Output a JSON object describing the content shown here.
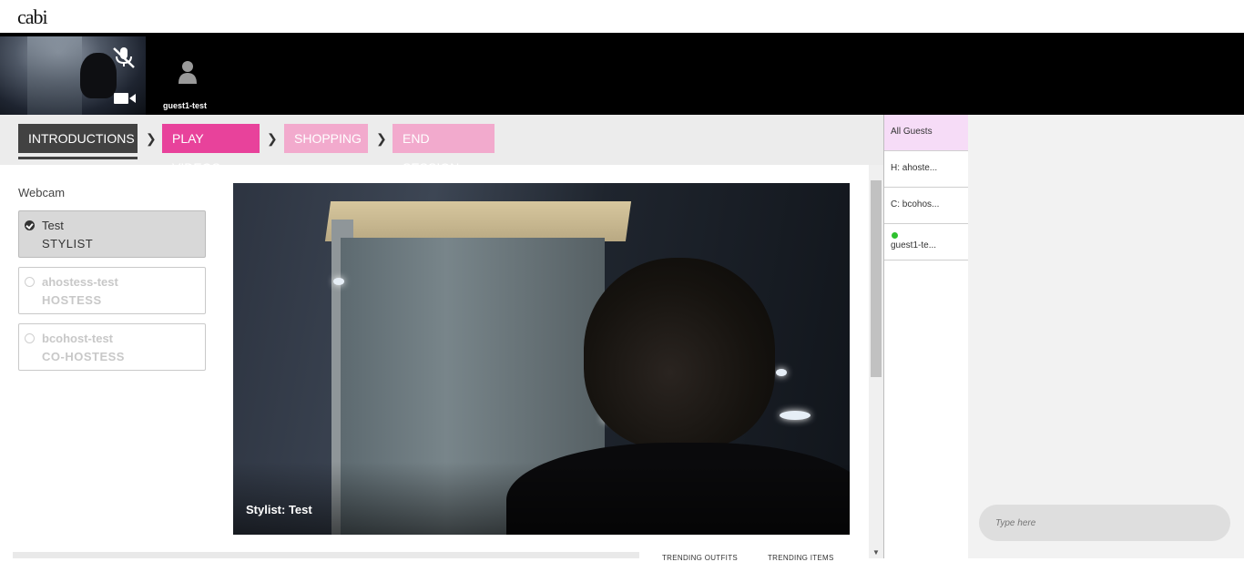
{
  "app": {
    "logo": "cabi"
  },
  "video_strip": {
    "guest_name": "guest1-test"
  },
  "steps": {
    "items": [
      {
        "label": "INTRODUCTIONS",
        "state": "active"
      },
      {
        "label": "PLAY VIDEOS",
        "state": "current"
      },
      {
        "label": "SHOPPING",
        "state": "upcoming"
      },
      {
        "label": "END SESSION",
        "state": "upcoming"
      }
    ]
  },
  "webcam": {
    "label": "Webcam",
    "participants": [
      {
        "name": "Test",
        "role": "STYLIST",
        "selected": true
      },
      {
        "name": "ahostess-test",
        "role": "HOSTESS",
        "selected": false
      },
      {
        "name": "bcohost-test",
        "role": "CO-HOSTESS",
        "selected": false
      }
    ]
  },
  "stage": {
    "caption": "Stylist: Test"
  },
  "bottom_tabs": [
    "TRENDING OUTFITS",
    "TRENDING ITEMS"
  ],
  "guests": {
    "all_label": "All Guests",
    "items": [
      {
        "label": "H: ahoste..."
      },
      {
        "label": "C: bcohos..."
      },
      {
        "label": "guest1-te...",
        "online": true
      }
    ]
  },
  "chat": {
    "placeholder": "Type here"
  },
  "colors": {
    "accent": "#e8429b",
    "accent_light": "#f2aacd",
    "active_step": "#424242",
    "online": "#2fc12f",
    "guest_highlight": "#f6dcf7"
  }
}
